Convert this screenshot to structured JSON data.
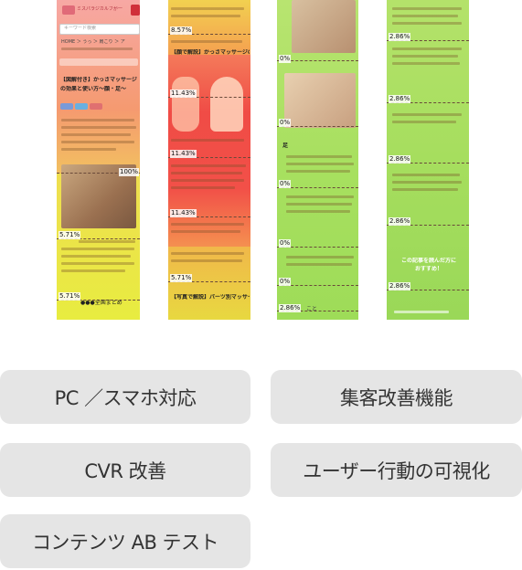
{
  "screenshots": [
    {
      "site_name": "ミスパラジカルフが一",
      "search_placeholder": "キーワード検索",
      "breadcrumb": "HOME ＞ うっ ＞ 肩こり ＞ ア",
      "article_title_line1": "【図解付き】かっさマッサージ",
      "article_title_line2": "の効果と使い方〜顔・足〜",
      "section_heading": "●●●全国まとめ",
      "markers": [
        "100%",
        "5.71%",
        "5.71%"
      ]
    },
    {
      "section_heading_1": "【顔で解説】かっさマッサージの方法",
      "section_heading_2": "【写真で解説】パーツ別マッサージの方法",
      "markers": [
        "8.57%",
        "11.43%",
        "11.43%",
        "11.43%",
        "5.71%"
      ]
    },
    {
      "section_heading": "足",
      "markers": [
        "0%",
        "0%",
        "0%",
        "0%",
        "0%",
        "2.86%"
      ],
      "footer_text": "こと"
    },
    {
      "cta_line1": "この記事を読んだ方に",
      "cta_line2": "おすすめ！",
      "markers": [
        "2.86%",
        "2.86%",
        "2.86%",
        "2.86%",
        "2.86%"
      ]
    }
  ],
  "features": [
    "PC ／スマホ対応",
    "集客改善機能",
    "CVR 改善",
    "ユーザー行動の可視化",
    "コンテンツ AB テスト"
  ],
  "colors": {
    "heat_red": "#f0504a",
    "heat_orange": "#f6a04a",
    "heat_yellow": "#ecec3c",
    "heat_green": "#a8e060",
    "pill_bg": "#e5e5e5"
  }
}
